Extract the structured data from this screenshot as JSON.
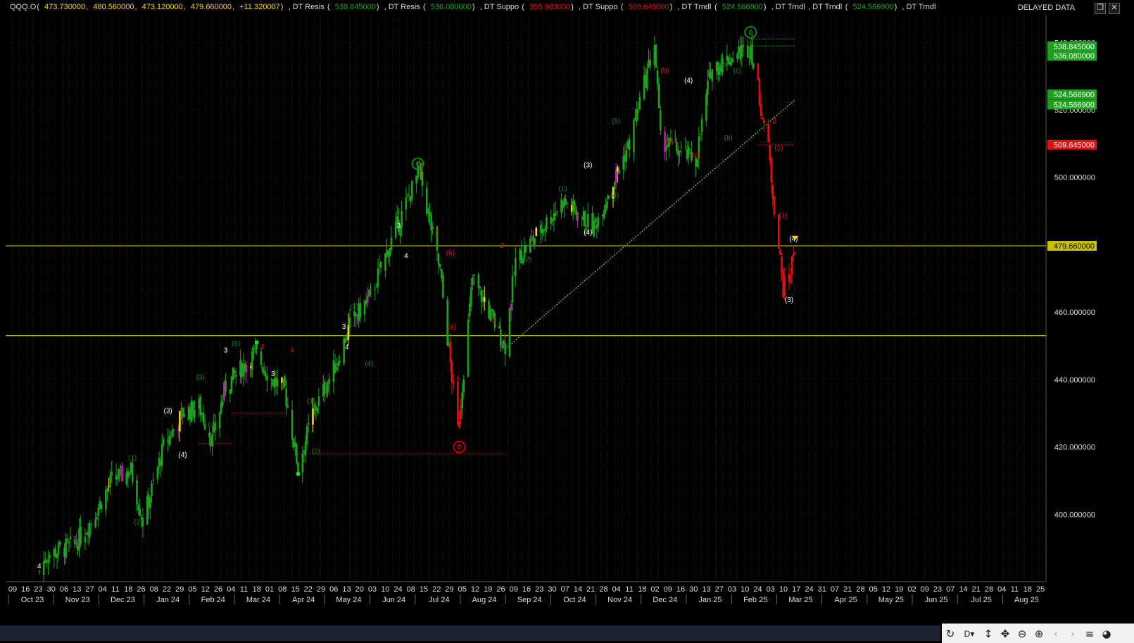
{
  "header": {
    "symbol": "QQQ.O",
    "ohlc": [
      "473.730000",
      "480.560000",
      "473.120000",
      "479.660000",
      "+11.320007"
    ],
    "indicators": [
      {
        "name": "DT Resis",
        "value": "538.845000",
        "color": "#1fa11f"
      },
      {
        "name": "DT Resis",
        "value": "536.080000",
        "color": "#1fa11f"
      },
      {
        "name": "DT Suppo",
        "value": "355.983000",
        "color": "#e01010"
      },
      {
        "name": "DT Suppo",
        "value": "509.645000",
        "color": "#e01010"
      },
      {
        "name": "DT Trndl",
        "value": "524.566900",
        "color": "#1fa11f"
      },
      {
        "name": "DT Trndl",
        "value": ""
      },
      {
        "name": "DT Trndl",
        "value": "524.566900",
        "color": "#1fa11f"
      },
      {
        "name": "DT Trndl",
        "value": ""
      }
    ],
    "status": "DELAYED DATA",
    "restore_icon": "restore-icon",
    "close_icon": "close-icon"
  },
  "colors": {
    "up": "#1fa11f",
    "down": "#e01010",
    "highlight": "#ffd21e",
    "magenta": "#c020b0",
    "hline": "#c9c200",
    "trendline": "#9acd32",
    "label_green": "#1a7f1a",
    "label_red": "#c00000",
    "label_yellow": "#e7d500"
  },
  "chart_data": {
    "type": "candlestick",
    "ylim": [
      380,
      548
    ],
    "y_ticks": [
      400,
      420,
      440,
      460,
      480,
      500,
      520,
      540
    ],
    "y_tick_labels": [
      "400.000000",
      "420.000000",
      "440.000000",
      "460.000000",
      "480.000000",
      "500.000000",
      "520.000000",
      "540.000000"
    ],
    "x_range": [
      "2023-10-09",
      "2025-09-01"
    ],
    "day_ticks": [
      "09",
      "16",
      "23",
      "30",
      "06",
      "13",
      "27",
      "04",
      "11",
      "18",
      "26",
      "08",
      "22",
      "29",
      "05",
      "12",
      "26",
      "04",
      "11",
      "18",
      "01",
      "08",
      "15",
      "22",
      "29",
      "06",
      "13",
      "20",
      "03",
      "10",
      "24",
      "08",
      "15",
      "22",
      "29",
      "05",
      "12",
      "19",
      "26",
      "09",
      "16",
      "23",
      "30",
      "07",
      "14",
      "21",
      "28",
      "04",
      "11",
      "18",
      "02",
      "09",
      "16",
      "30",
      "13",
      "27",
      "03",
      "10",
      "24",
      "03",
      "10",
      "17",
      "24",
      "31",
      "07",
      "21",
      "28",
      "05",
      "12",
      "19",
      "02",
      "09",
      "23",
      "07",
      "14",
      "21",
      "28",
      "04",
      "11",
      "18",
      "25"
    ],
    "month_ticks": [
      "Oct 23",
      "Nov 23",
      "Dec 23",
      "Jan 24",
      "Feb 24",
      "Mar 24",
      "Apr 24",
      "May 24",
      "Jun 24",
      "Jul 24",
      "Aug 24",
      "Sep 24",
      "Oct 24",
      "Nov 24",
      "Dec 24",
      "Jan 25",
      "Feb 25",
      "Mar 25",
      "Apr 25",
      "May 25",
      "Jun 25",
      "Jul 25",
      "Aug 25"
    ],
    "price_path": [
      {
        "date": "2023-10-27",
        "close": 383
      },
      {
        "date": "2023-11-01",
        "close": 388
      },
      {
        "date": "2023-11-20",
        "close": 391
      },
      {
        "date": "2023-12-01",
        "close": 398
      },
      {
        "date": "2023-12-15",
        "close": 410
      },
      {
        "date": "2023-12-28",
        "close": 413
      },
      {
        "date": "2024-01-05",
        "close": 398
      },
      {
        "date": "2024-01-19",
        "close": 420
      },
      {
        "date": "2024-02-01",
        "close": 430
      },
      {
        "date": "2024-02-12",
        "close": 432
      },
      {
        "date": "2024-02-21",
        "close": 422
      },
      {
        "date": "2024-03-01",
        "close": 438
      },
      {
        "date": "2024-03-21",
        "close": 448
      },
      {
        "date": "2024-04-01",
        "close": 440
      },
      {
        "date": "2024-04-10",
        "close": 437
      },
      {
        "date": "2024-04-19",
        "close": 414
      },
      {
        "date": "2024-04-29",
        "close": 430
      },
      {
        "date": "2024-05-15",
        "close": 445
      },
      {
        "date": "2024-05-24",
        "close": 456
      },
      {
        "date": "2024-06-07",
        "close": 465
      },
      {
        "date": "2024-06-20",
        "close": 480
      },
      {
        "date": "2024-07-10",
        "close": 502
      },
      {
        "date": "2024-07-24",
        "close": 472
      },
      {
        "date": "2024-08-05",
        "close": 425
      },
      {
        "date": "2024-08-15",
        "close": 470
      },
      {
        "date": "2024-09-06",
        "close": 450
      },
      {
        "date": "2024-09-13",
        "close": 475
      },
      {
        "date": "2024-10-15",
        "close": 493
      },
      {
        "date": "2024-11-05",
        "close": 485
      },
      {
        "date": "2024-11-29",
        "close": 510
      },
      {
        "date": "2024-12-16",
        "close": 540
      },
      {
        "date": "2024-12-20",
        "close": 511
      },
      {
        "date": "2025-01-13",
        "close": 505
      },
      {
        "date": "2025-01-23",
        "close": 532
      },
      {
        "date": "2025-02-19",
        "close": 539
      },
      {
        "date": "2025-03-03",
        "close": 508
      },
      {
        "date": "2025-03-13",
        "close": 467
      },
      {
        "date": "2025-03-17",
        "close": 470
      },
      {
        "date": "2025-03-21",
        "close": 479.66
      }
    ],
    "h_lines": [
      479.66,
      453
    ],
    "price_labels": [
      {
        "value": 538.845,
        "label": "538.845000",
        "color": "#1fa11f"
      },
      {
        "value": 536.08,
        "label": "536.080000",
        "color": "#1fa11f"
      },
      {
        "value": 524.5669,
        "label": "524.566900",
        "color": "#1fa11f"
      },
      {
        "value": 521.6,
        "label": "524.566900",
        "color": "#1fa11f"
      },
      {
        "value": 509.645,
        "label": "509.645000",
        "color": "#e01010"
      },
      {
        "value": 479.66,
        "label": "479.660000",
        "color": "#c9c200"
      }
    ],
    "trendline": {
      "from": {
        "date": "2024-09-06",
        "value": 449
      },
      "to": {
        "date": "2025-03-21",
        "value": 523
      }
    },
    "support_lines": [
      {
        "from": "2024-04-19",
        "to": "2024-09-06",
        "value": 418,
        "color": "#e01010"
      },
      {
        "from": "2024-02-12",
        "to": "2024-03-05",
        "value": 421,
        "color": "#e01010"
      },
      {
        "from": "2024-03-05",
        "to": "2024-04-10",
        "value": 430,
        "color": "#e01010"
      },
      {
        "from": "2025-02-24",
        "to": "2025-03-20",
        "value": 509.6,
        "color": "#e01010"
      },
      {
        "from": "2025-02-19",
        "to": "2025-03-21",
        "value": 541,
        "color": "#1fa11f"
      },
      {
        "from": "2025-02-19",
        "to": "2025-03-21",
        "value": 539,
        "color": "#1fa11f"
      }
    ],
    "wave_labels": [
      {
        "date": "2023-10-27",
        "value": 384,
        "text": "4",
        "color": "#ffffff"
      },
      {
        "date": "2023-11-20",
        "value": 392,
        "text": "3",
        "color": "#1a7f1a"
      },
      {
        "date": "2023-11-23",
        "value": 394,
        "text": "5",
        "color": "#1a7f1a"
      },
      {
        "date": "2023-12-29",
        "value": 416,
        "text": "(1)",
        "color": "#1a7f1a"
      },
      {
        "date": "2024-01-02",
        "value": 397,
        "text": "(2)",
        "color": "#1a7f1a"
      },
      {
        "date": "2024-01-22",
        "value": 430,
        "text": "(3)",
        "color": "#ffffff"
      },
      {
        "date": "2024-02-01",
        "value": 417,
        "text": "(4)",
        "color": "#ffffff"
      },
      {
        "date": "2024-02-21",
        "value": 426,
        "text": "(4)",
        "color": "#1a7f1a"
      },
      {
        "date": "2024-02-13",
        "value": 440,
        "text": "(3)",
        "color": "#1a7f1a"
      },
      {
        "date": "2024-03-01",
        "value": 448,
        "text": "3",
        "color": "#ffffff"
      },
      {
        "date": "2024-03-08",
        "value": 450,
        "text": "(5)",
        "color": "#1a7f1a"
      },
      {
        "date": "2024-03-26",
        "value": 449,
        "text": "2",
        "color": "#e01010"
      },
      {
        "date": "2024-04-02",
        "value": 441,
        "text": "3",
        "color": "#ffffff"
      },
      {
        "date": "2024-04-15",
        "value": 448,
        "text": "4",
        "color": "#e01010"
      },
      {
        "date": "2024-04-28",
        "value": 433,
        "text": "(1)",
        "color": "#1a7f1a"
      },
      {
        "date": "2024-05-01",
        "value": 418,
        "text": "(2)",
        "color": "#1a7f1a"
      },
      {
        "date": "2024-05-20",
        "value": 455,
        "text": "3",
        "color": "#ffffff"
      },
      {
        "date": "2024-05-22",
        "value": 449,
        "text": "4",
        "color": "#ffffff"
      },
      {
        "date": "2024-05-27",
        "value": 461,
        "text": "(3)",
        "color": "#1a7f1a"
      },
      {
        "date": "2024-06-06",
        "value": 444,
        "text": "(4)",
        "color": "#1a7f1a"
      },
      {
        "date": "2024-06-26",
        "value": 485,
        "text": "3",
        "color": "#ffffff"
      },
      {
        "date": "2024-07-01",
        "value": 476,
        "text": "4",
        "color": "#ffffff"
      },
      {
        "date": "2024-07-22",
        "value": 483,
        "text": "4",
        "color": "#e01010"
      },
      {
        "date": "2024-07-31",
        "value": 477,
        "text": "(b)",
        "color": "#e01010"
      },
      {
        "date": "2024-08-01",
        "value": 455,
        "text": "(a)",
        "color": "#e01010"
      },
      {
        "date": "2024-09-04",
        "value": 479,
        "text": "2",
        "color": "#e01010"
      },
      {
        "date": "2024-08-29",
        "value": 457,
        "text": "3",
        "color": "#e01010"
      },
      {
        "date": "2024-09-21",
        "value": 475,
        "text": "(2)",
        "color": "#1a7f1a"
      },
      {
        "date": "2024-10-15",
        "value": 496,
        "text": "(1)",
        "color": "#1a7f1a"
      },
      {
        "date": "2024-11-01",
        "value": 483,
        "text": "(4)",
        "color": "#ffffff"
      },
      {
        "date": "2024-11-01",
        "value": 503,
        "text": "(3)",
        "color": "#ffffff"
      },
      {
        "date": "2024-11-19",
        "value": 494,
        "text": "(4)",
        "color": "#1a7f1a"
      },
      {
        "date": "2024-11-20",
        "value": 516,
        "text": "(5)",
        "color": "#1a7f1a"
      },
      {
        "date": "2024-12-23",
        "value": 531,
        "text": "(b)",
        "color": "#e01010"
      },
      {
        "date": "2024-12-26",
        "value": 510,
        "text": "(a)",
        "color": "#e01010"
      },
      {
        "date": "2025-01-08",
        "value": 528,
        "text": "(4)",
        "color": "#ffffff"
      },
      {
        "date": "2025-01-13",
        "value": 506,
        "text": "(c)",
        "color": "#e01010"
      },
      {
        "date": "2025-02-01",
        "value": 533,
        "text": "(a)",
        "color": "#1a7f1a"
      },
      {
        "date": "2025-02-04",
        "value": 511,
        "text": "(b)",
        "color": "#1a7f1a"
      },
      {
        "date": "2025-02-10",
        "value": 531,
        "text": "(c)",
        "color": "#1a7f1a"
      },
      {
        "date": "2025-03-07",
        "value": 516,
        "text": "2",
        "color": "#e01010"
      },
      {
        "date": "2025-03-10",
        "value": 508,
        "text": "(2)",
        "color": "#e01010"
      },
      {
        "date": "2025-03-13",
        "value": 488,
        "text": "(1)",
        "color": "#e01010"
      },
      {
        "date": "2025-03-20",
        "value": 481,
        "text": "(4)",
        "color": "#ffffff"
      },
      {
        "date": "2025-03-17",
        "value": 463,
        "text": "(3)",
        "color": "#ffffff"
      }
    ],
    "circle_markers": [
      {
        "date": "2024-07-09",
        "value": 504,
        "text": "0",
        "color": "#1a7f1a"
      },
      {
        "date": "2024-08-06",
        "value": 420,
        "text": "0",
        "color": "#c00000"
      },
      {
        "date": "2025-02-19",
        "value": 543,
        "text": "0",
        "color": "#1a7f1a"
      }
    ]
  },
  "toolbar": {
    "items": [
      "refresh-icon",
      "D",
      "range-icon",
      "pan-icon",
      "zoom-out-icon",
      "zoom-in-icon",
      "back-icon",
      "forward-icon",
      "list-icon",
      "palette-icon"
    ],
    "period_label": "D"
  }
}
